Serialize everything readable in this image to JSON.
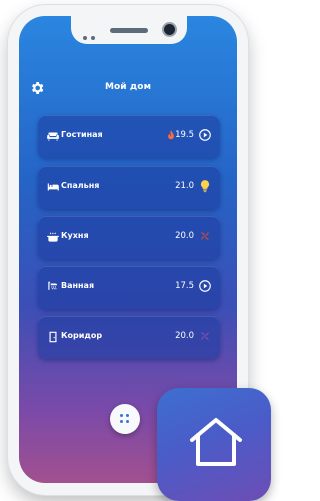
{
  "app": {
    "title": "Мой дом"
  },
  "rooms": [
    {
      "name": "Гостиная",
      "temp": "19.5",
      "icon": "sofa-icon",
      "status_icon": "play-circle-icon",
      "extra_icon": "flame-icon"
    },
    {
      "name": "Спальня",
      "temp": "21.0",
      "icon": "bed-icon",
      "status_icon": "lightbulb-icon"
    },
    {
      "name": "Кухня",
      "temp": "20.0",
      "icon": "pot-icon",
      "status_icon": "fan-icon"
    },
    {
      "name": "Ванная",
      "temp": "17.5",
      "icon": "shower-icon",
      "status_icon": "play-circle-icon"
    },
    {
      "name": "Коридор",
      "temp": "20.0",
      "icon": "door-icon",
      "status_icon": "fan-icon"
    }
  ],
  "colors": {
    "accent": "#3a73d6",
    "bulb": "#ffd24d",
    "flame": "#ff6a3d"
  }
}
